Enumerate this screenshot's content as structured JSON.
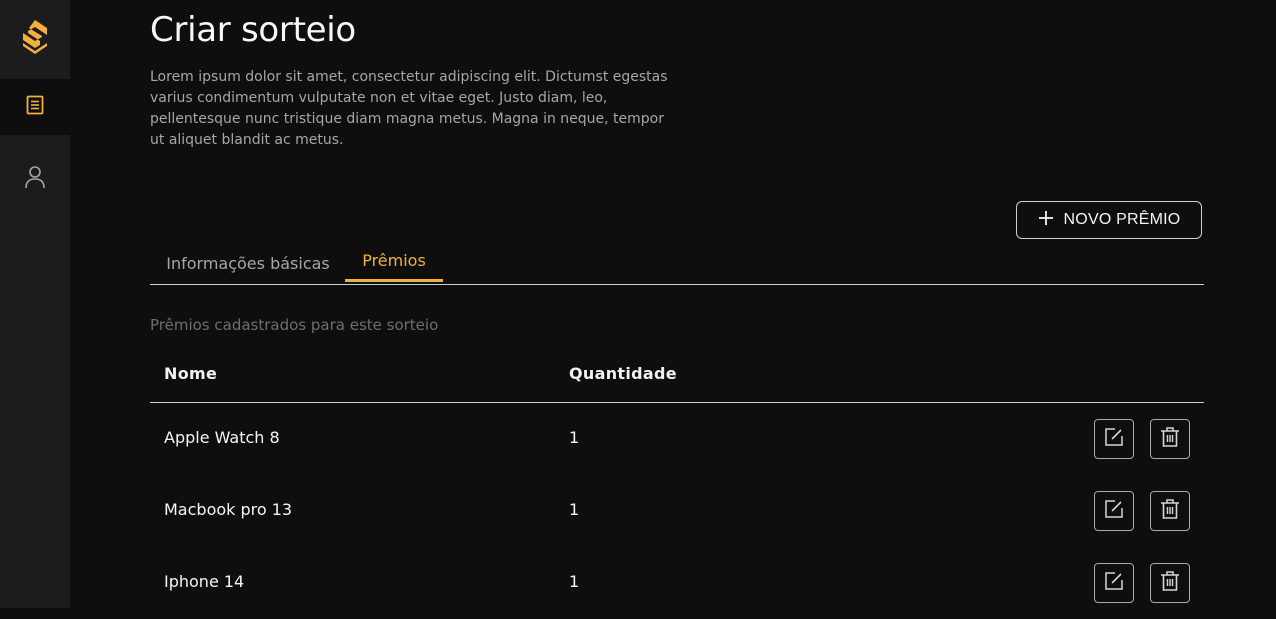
{
  "colors": {
    "background": "#0e0e0f",
    "sidebar": "#1c1c1e",
    "accent": "#f4b03c",
    "muted_text": "#a6a6a6"
  },
  "sidebar": {
    "logo": "brand-logo-icon",
    "items": [
      {
        "icon": "document-list-icon",
        "active": true
      },
      {
        "icon": "user-icon",
        "active": false
      }
    ]
  },
  "page": {
    "title": "Criar sorteio",
    "description": "Lorem ipsum dolor sit amet, consectetur adipiscing elit. Dictumst egestas varius condimentum vulputate non et vitae eget. Justo diam, leo, pellentesque nunc tristique diam magna metus. Magna in neque, tempor ut aliquet blandit ac metus."
  },
  "toolbar": {
    "add_prize_label": "NOVO PRÊMIO"
  },
  "tabs": [
    {
      "label": "Informações básicas",
      "active": false
    },
    {
      "label": "Prêmios",
      "active": true
    }
  ],
  "prizes": {
    "caption": "Prêmios cadastrados para este sorteio",
    "columns": [
      "Nome",
      "Quantidade"
    ],
    "rows": [
      {
        "name": "Apple Watch 8",
        "quantity": "1"
      },
      {
        "name": "Macbook pro 13",
        "quantity": "1"
      },
      {
        "name": "Iphone 14",
        "quantity": "1"
      }
    ]
  }
}
